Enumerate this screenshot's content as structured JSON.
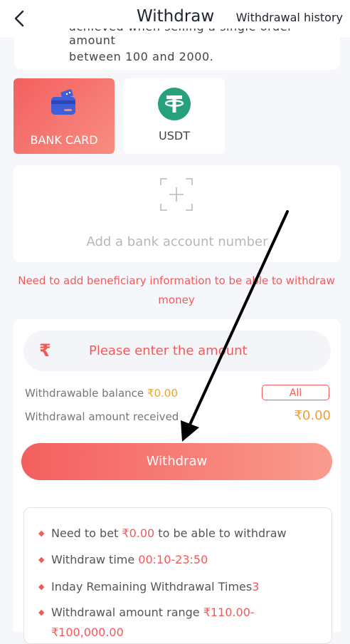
{
  "header": {
    "title": "Withdraw",
    "history_label": "Withdrawal history"
  },
  "notice": {
    "line1": "achieved when selling a single order amount",
    "line2": "between 100 and 2000."
  },
  "methods": [
    {
      "label": "BANK CARD",
      "icon": "bank-card-icon",
      "active": true
    },
    {
      "label": "USDT",
      "icon": "tether-icon",
      "active": false
    }
  ],
  "bank_account": {
    "add_label": "Add a bank account number"
  },
  "warning": "Need to add beneficiary information to be able to withdraw money",
  "amount": {
    "currency_symbol": "₹",
    "placeholder": "Please enter the amount",
    "withdrawable_label": "Withdrawable balance ",
    "withdrawable_value": "₹0.00",
    "all_label": "All",
    "received_label": "Withdrawal amount received",
    "received_value": "₹0.00",
    "withdraw_button": "Withdraw"
  },
  "rules": {
    "r1_prefix": "Need to bet ",
    "r1_value": "₹0.00",
    "r1_suffix": " to be able to withdraw",
    "r2_prefix": "Withdraw time ",
    "r2_value": "00:10-23:50",
    "r3_prefix": "Inday Remaining Withdrawal Times",
    "r3_value": "3",
    "r4_prefix": "Withdrawal amount range ",
    "r4_value": "₹110.00-",
    "r4_value2": "₹100,000.00"
  },
  "colors": {
    "accent": "#f25a5a",
    "gold": "#e9a23b",
    "usdt_green": "#26a17b"
  }
}
